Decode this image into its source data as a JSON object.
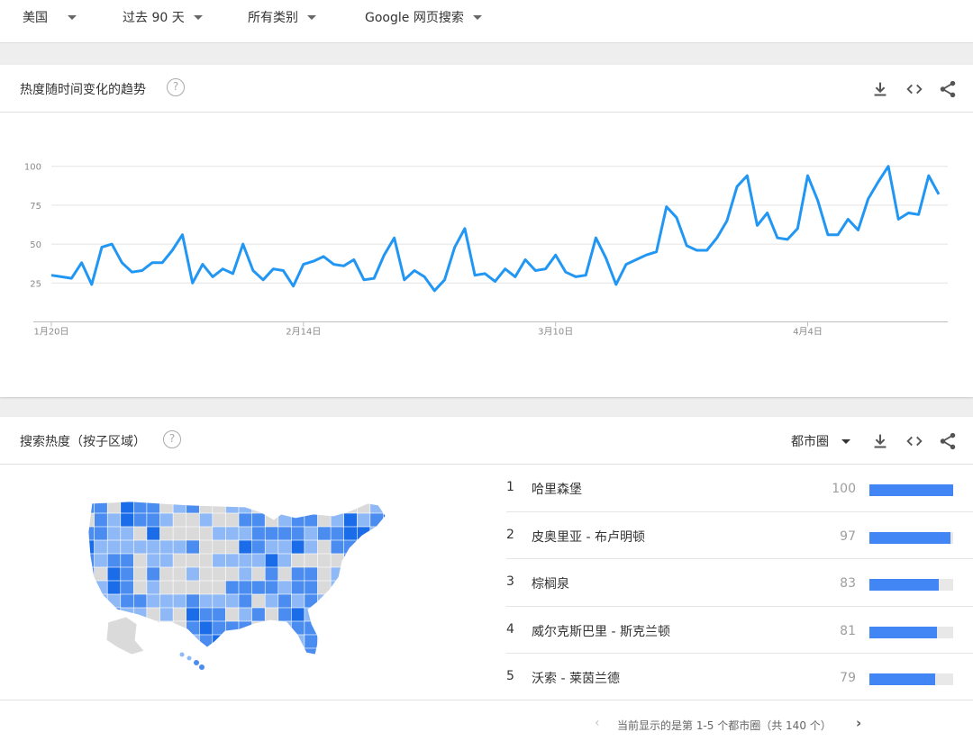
{
  "filters": {
    "region": "美国",
    "time": "过去 90 天",
    "category": "所有类别",
    "search_type": "Google 网页搜索"
  },
  "trend_card": {
    "title": "热度随时间变化的趋势",
    "help": "?"
  },
  "chart_data": {
    "type": "line",
    "color": "#2196f3",
    "x_tick_labels": [
      "1月20日",
      "2月14日",
      "3月10日",
      "4月4日"
    ],
    "x_tick_index": [
      0,
      25,
      50,
      75
    ],
    "y_ticks": [
      25,
      50,
      75,
      100
    ],
    "ylim": [
      0,
      100
    ],
    "grid": true,
    "values": [
      30,
      29,
      28,
      38,
      24,
      48,
      50,
      38,
      32,
      33,
      38,
      38,
      46,
      56,
      25,
      37,
      29,
      34,
      31,
      50,
      33,
      27,
      34,
      33,
      23,
      37,
      39,
      42,
      37,
      36,
      40,
      27,
      28,
      43,
      54,
      27,
      33,
      29,
      20,
      27,
      48,
      60,
      30,
      31,
      26,
      34,
      29,
      40,
      33,
      34,
      43,
      32,
      29,
      30,
      54,
      41,
      24,
      37,
      40,
      43,
      45,
      74,
      67,
      49,
      46,
      46,
      54,
      65,
      87,
      94,
      62,
      70,
      54,
      53,
      60,
      94,
      78,
      56,
      56,
      66,
      59,
      79,
      90,
      100,
      66,
      70,
      69,
      94,
      82
    ]
  },
  "region_card": {
    "title": "搜索热度（按子区域）",
    "help": "?",
    "region_level": "都市圈",
    "map_colors": {
      "dark": "#1a6ce8",
      "mid": "#4a8cef",
      "light": "#8fb9f6",
      "none": "#dadada"
    },
    "rankings": [
      {
        "rank": "1",
        "name": "哈里森堡",
        "value": 100
      },
      {
        "rank": "2",
        "name": "皮奥里亚 - 布卢明顿",
        "value": 97
      },
      {
        "rank": "3",
        "name": "棕榈泉",
        "value": 83
      },
      {
        "rank": "4",
        "name": "威尔克斯巴里 - 斯克兰顿",
        "value": 81
      },
      {
        "rank": "5",
        "name": "沃索 - 莱茵兰德",
        "value": 79
      }
    ],
    "pager_text": "当前显示的是第 1-5 个都市圈（共 140 个）"
  },
  "icons": {
    "download": "download-icon",
    "embed": "embed-code-icon",
    "share": "share-icon",
    "prev": "chevron-left-icon",
    "next": "chevron-right-icon"
  }
}
